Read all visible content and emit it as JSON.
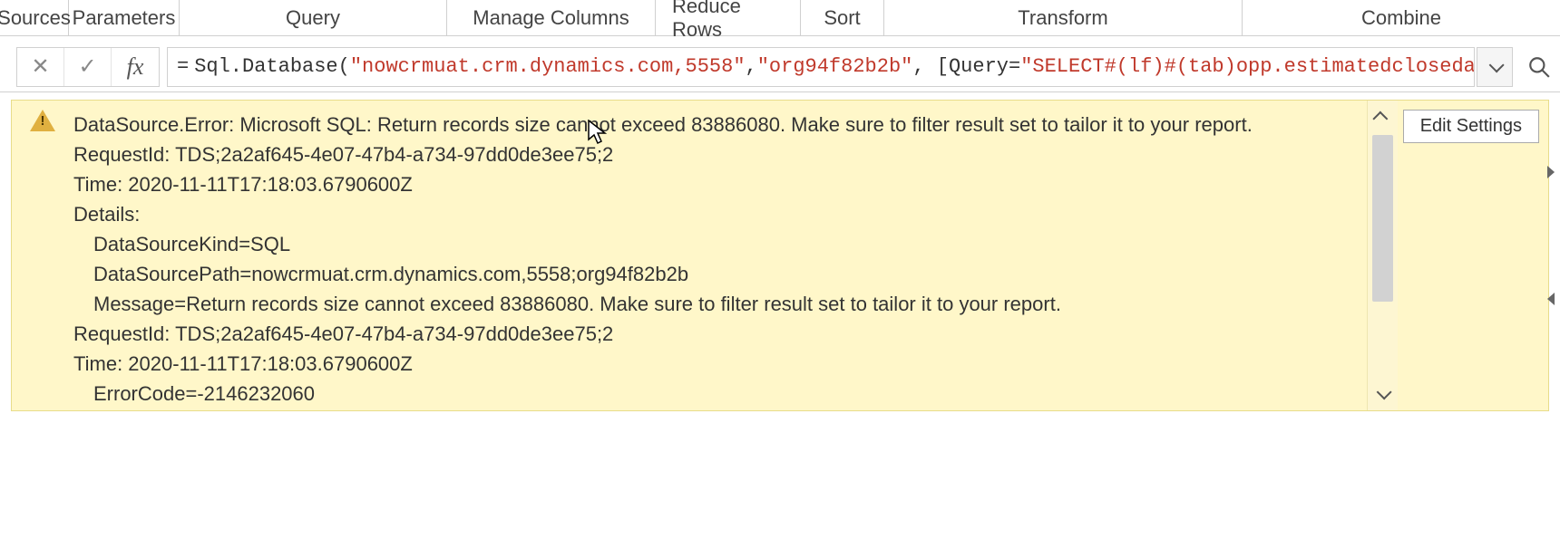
{
  "ribbon": {
    "sources": "Sources",
    "parameters": "Parameters",
    "query": "Query",
    "manage_columns": "Manage Columns",
    "reduce_rows": "Reduce Rows",
    "sort": "Sort",
    "transform": "Transform",
    "combine": "Combine"
  },
  "formula_bar": {
    "cancel": "✕",
    "accept": "✓",
    "fx": "fx",
    "eq": "=",
    "fn_name": "Sql.Database",
    "open": "(",
    "str1": "\"nowcrmuat.crm.dynamics.com,5558\"",
    "sep1": ", ",
    "str2": "\"org94f82b2b\"",
    "sep2": ", [",
    "param": "Query=",
    "str3": "\"SELECT#(lf)#(tab)opp.estimatedclosedate"
  },
  "error": {
    "line1": "DataSource.Error: Microsoft SQL: Return records size cannot exceed 83886080. Make sure to filter result set to tailor it to your report.",
    "line2": "RequestId: TDS;2a2af645-4e07-47b4-a734-97dd0de3ee75;2",
    "line3": "Time: 2020-11-11T17:18:03.6790600Z",
    "line4": "Details:",
    "line5": "DataSourceKind=SQL",
    "line6": "DataSourcePath=nowcrmuat.crm.dynamics.com,5558;org94f82b2b",
    "line7": "Message=Return records size cannot exceed 83886080. Make sure to filter result set to tailor it to your report.",
    "line8": "RequestId: TDS;2a2af645-4e07-47b4-a734-97dd0de3ee75;2",
    "line9": "Time: 2020-11-11T17:18:03.6790600Z",
    "line10": "ErrorCode=-2146232060"
  },
  "buttons": {
    "edit_settings": "Edit Settings"
  }
}
